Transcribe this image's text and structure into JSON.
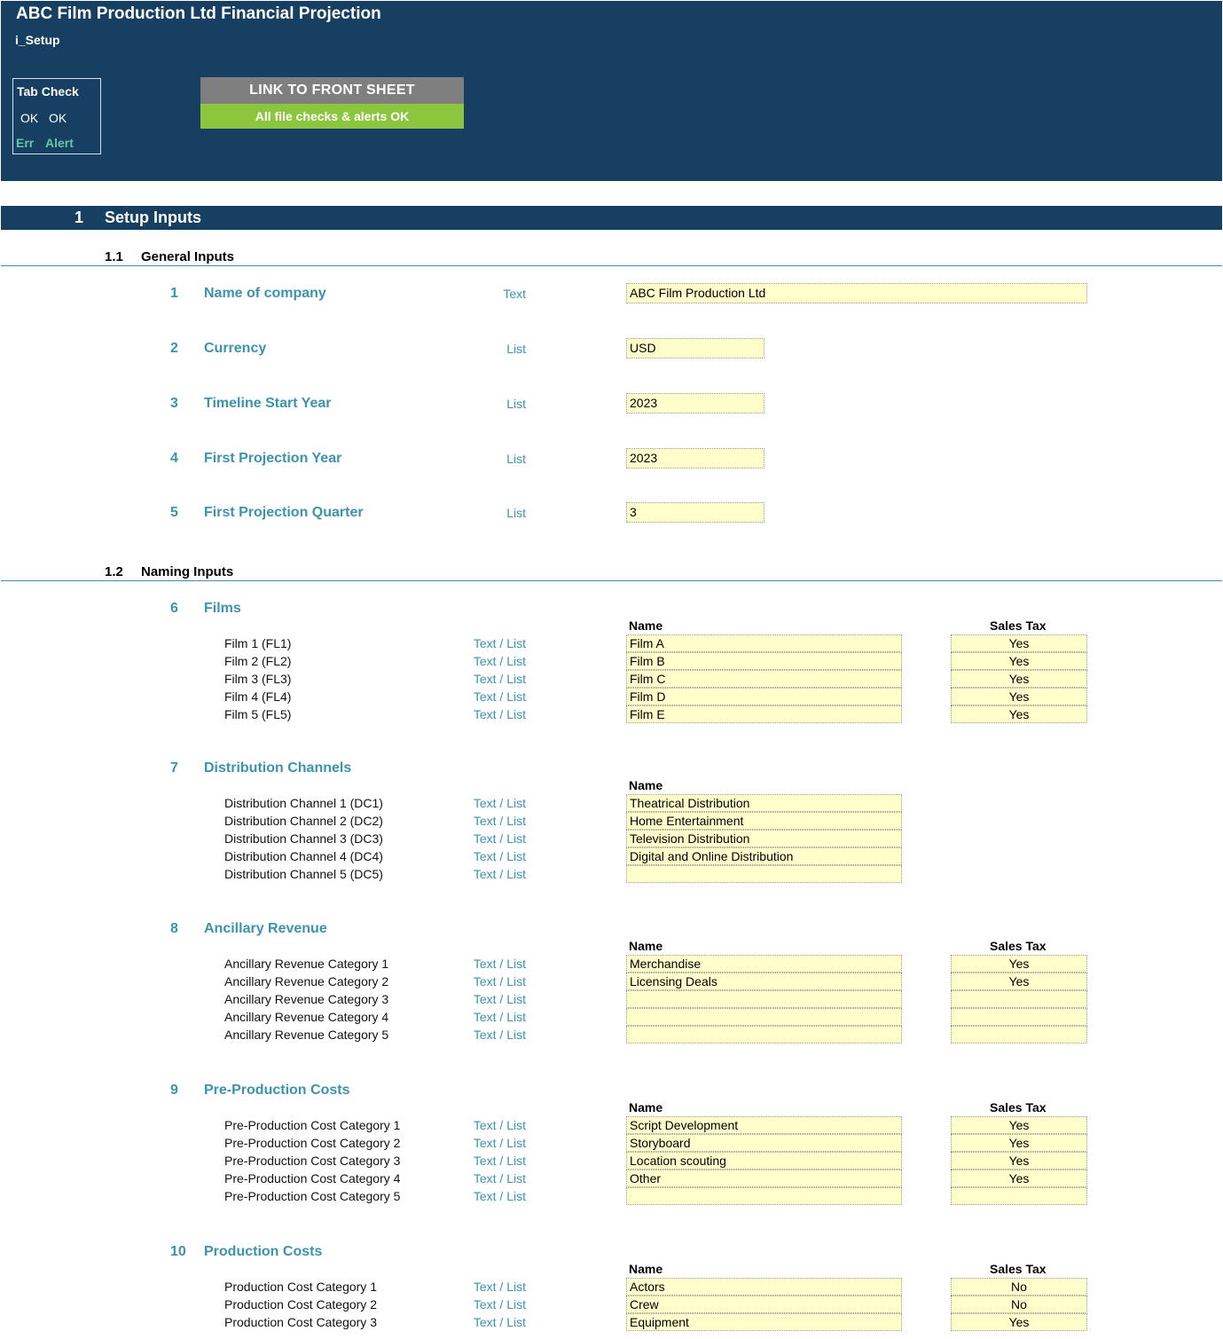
{
  "header": {
    "title": "ABC Film Production Ltd Financial Projection",
    "sheet": "i_Setup",
    "tab_check": {
      "title": "Tab Check",
      "ok1": "OK",
      "ok2": "OK",
      "err": "Err",
      "alert": "Alert"
    },
    "link_button": "LINK TO FRONT SHEET",
    "checks_status": "All file checks & alerts OK"
  },
  "section": {
    "number": "1",
    "title": "Setup Inputs"
  },
  "general": {
    "number": "1.1",
    "title": "General Inputs",
    "items": [
      {
        "num": "1",
        "label": "Name of company",
        "type": "Text",
        "value": "ABC Film Production Ltd"
      },
      {
        "num": "2",
        "label": "Currency",
        "type": "List",
        "value": "USD"
      },
      {
        "num": "3",
        "label": "Timeline Start Year",
        "type": "List",
        "value": "2023"
      },
      {
        "num": "4",
        "label": "First Projection Year",
        "type": "List",
        "value": "2023"
      },
      {
        "num": "5",
        "label": "First Projection Quarter",
        "type": "List",
        "value": "3"
      }
    ]
  },
  "naming": {
    "number": "1.2",
    "title": "Naming Inputs",
    "name_header": "Name",
    "tax_header": "Sales Tax",
    "groups": [
      {
        "num": "6",
        "title": "Films",
        "has_tax": true,
        "rows": [
          {
            "label": "Film 1 (FL1)",
            "type": "Text / List",
            "name": "Film A",
            "tax": "Yes"
          },
          {
            "label": "Film 2 (FL2)",
            "type": "Text / List",
            "name": "Film B",
            "tax": "Yes"
          },
          {
            "label": "Film 3 (FL3)",
            "type": "Text / List",
            "name": "Film C",
            "tax": "Yes"
          },
          {
            "label": "Film 4 (FL4)",
            "type": "Text / List",
            "name": "Film D",
            "tax": "Yes"
          },
          {
            "label": "Film 5 (FL5)",
            "type": "Text / List",
            "name": "Film E",
            "tax": "Yes"
          }
        ]
      },
      {
        "num": "7",
        "title": "Distribution Channels",
        "has_tax": false,
        "rows": [
          {
            "label": "Distribution Channel 1 (DC1)",
            "type": "Text / List",
            "name": "Theatrical Distribution"
          },
          {
            "label": "Distribution Channel 2 (DC2)",
            "type": "Text / List",
            "name": "Home Entertainment"
          },
          {
            "label": "Distribution Channel 3 (DC3)",
            "type": "Text / List",
            "name": "Television Distribution"
          },
          {
            "label": "Distribution Channel 4 (DC4)",
            "type": "Text / List",
            "name": "Digital and Online Distribution"
          },
          {
            "label": "Distribution Channel 5 (DC5)",
            "type": "Text / List",
            "name": ""
          }
        ]
      },
      {
        "num": "8",
        "title": "Ancillary Revenue",
        "has_tax": true,
        "rows": [
          {
            "label": "Ancillary Revenue Category 1",
            "type": "Text / List",
            "name": "Merchandise",
            "tax": "Yes"
          },
          {
            "label": "Ancillary Revenue Category 2",
            "type": "Text / List",
            "name": "Licensing Deals",
            "tax": "Yes"
          },
          {
            "label": "Ancillary Revenue Category 3",
            "type": "Text / List",
            "name": "",
            "tax": ""
          },
          {
            "label": "Ancillary Revenue Category 4",
            "type": "Text / List",
            "name": "",
            "tax": ""
          },
          {
            "label": "Ancillary Revenue Category 5",
            "type": "Text / List",
            "name": "",
            "tax": ""
          }
        ]
      },
      {
        "num": "9",
        "title": "Pre-Production Costs",
        "has_tax": true,
        "rows": [
          {
            "label": "Pre-Production Cost Category 1",
            "type": "Text / List",
            "name": "Script Development",
            "tax": "Yes"
          },
          {
            "label": "Pre-Production Cost Category 2",
            "type": "Text / List",
            "name": "Storyboard",
            "tax": "Yes"
          },
          {
            "label": "Pre-Production Cost Category 3",
            "type": "Text / List",
            "name": "Location scouting",
            "tax": "Yes"
          },
          {
            "label": "Pre-Production Cost Category 4",
            "type": "Text / List",
            "name": "Other",
            "tax": "Yes"
          },
          {
            "label": "Pre-Production Cost Category 5",
            "type": "Text / List",
            "name": "",
            "tax": ""
          }
        ]
      },
      {
        "num": "10",
        "title": "Production Costs",
        "has_tax": true,
        "rows": [
          {
            "label": "Production Cost Category 1",
            "type": "Text / List",
            "name": "Actors",
            "tax": "No"
          },
          {
            "label": "Production Cost Category 2",
            "type": "Text / List",
            "name": "Crew",
            "tax": "No"
          },
          {
            "label": "Production Cost Category 3",
            "type": "Text / List",
            "name": "Equipment",
            "tax": "Yes"
          }
        ]
      }
    ]
  }
}
